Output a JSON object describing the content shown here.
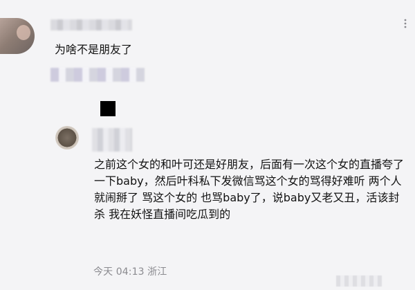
{
  "comment": {
    "text": "为啥不是朋友了"
  },
  "reply": {
    "text": "之前这个女的和叶可还是好朋友，后面有一次这个女的直播夸了一下baby，然后叶科私下发微信骂这个女的骂得好难听 两个人就闹掰了 骂这个女的 也骂baby了，说baby又老又丑，活该封杀 我在妖怪直播间吃瓜到的",
    "time": "今天 04:13",
    "location": "浙江"
  },
  "icons": {
    "more": "more-icon"
  }
}
